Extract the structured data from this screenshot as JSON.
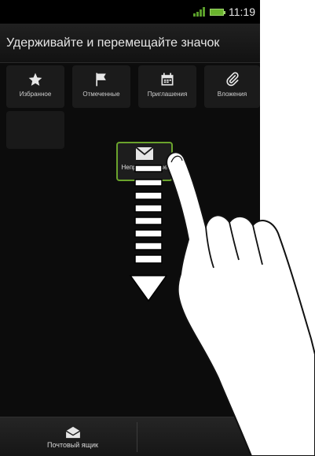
{
  "status": {
    "time": "11:19"
  },
  "header": {
    "title": "Удерживайте и перемещайте значок"
  },
  "tabs": [
    {
      "label": "Избранное",
      "icon": "star-icon"
    },
    {
      "label": "Отмеченные",
      "icon": "flag-icon"
    },
    {
      "label": "Приглашения",
      "icon": "calendar-icon"
    },
    {
      "label": "Вложения",
      "icon": "paperclip-icon"
    }
  ],
  "dragged": {
    "label": "Непрочитанные",
    "icon": "envelope-icon"
  },
  "bottom": {
    "label": "Почтовый ящик",
    "icon": "inbox-icon"
  },
  "colors": {
    "accent": "#6aa32c",
    "background": "#0c0c0c"
  }
}
